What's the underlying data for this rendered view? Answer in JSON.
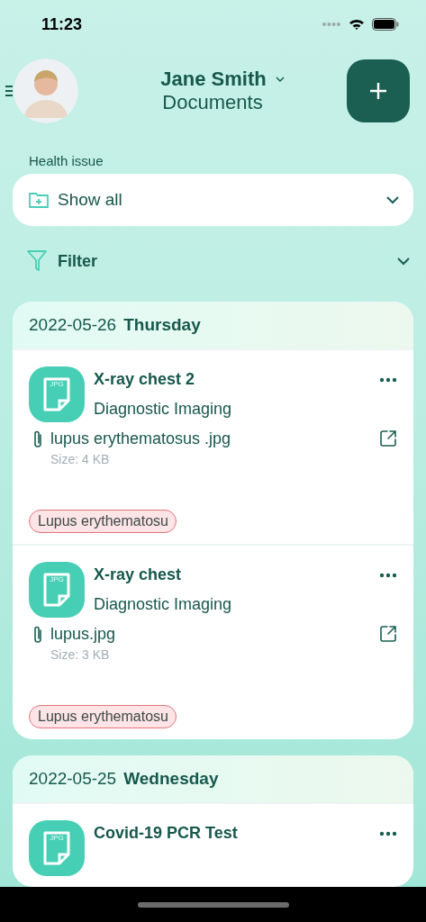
{
  "status_bar": {
    "time": "11:23"
  },
  "header": {
    "user_name": "Jane Smith",
    "title": "Documents"
  },
  "health_issue": {
    "label": "Health issue",
    "value": "Show all"
  },
  "filter": {
    "label": "Filter",
    "expanded": false
  },
  "groups": [
    {
      "date": "2022-05-26",
      "weekday": "Thursday",
      "documents": [
        {
          "file_type": "JPG",
          "title": "X-ray chest 2",
          "category": "Diagnostic Imaging",
          "file_name": "lupus erythematosus .jpg",
          "size": "Size: 4 KB",
          "tags": [
            {
              "label": "Lupus erythematosu",
              "color": "#e8737a"
            }
          ]
        },
        {
          "file_type": "JPG",
          "title": "X-ray chest",
          "category": "Diagnostic Imaging",
          "file_name": "lupus.jpg",
          "size": "Size: 3 KB",
          "tags": [
            {
              "label": "Lupus erythematosu",
              "color": "#e8737a"
            }
          ]
        }
      ]
    },
    {
      "date": "2022-05-25",
      "weekday": "Wednesday",
      "documents": [
        {
          "file_type": "JPG",
          "title": "Covid-19 PCR Test"
        }
      ]
    }
  ]
}
